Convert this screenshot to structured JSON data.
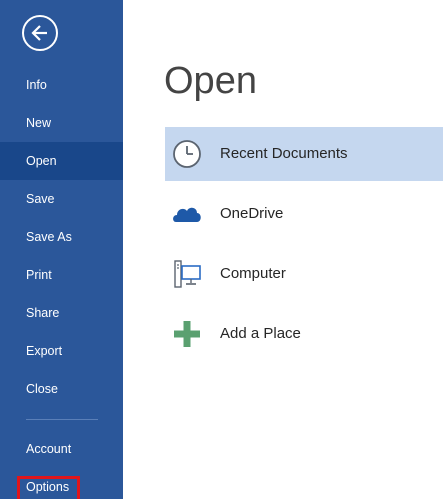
{
  "sidebar": {
    "back_icon": "back-arrow-icon",
    "items": [
      {
        "label": "Info"
      },
      {
        "label": "New"
      },
      {
        "label": "Open"
      },
      {
        "label": "Save"
      },
      {
        "label": "Save As"
      },
      {
        "label": "Print"
      },
      {
        "label": "Share"
      },
      {
        "label": "Export"
      },
      {
        "label": "Close"
      },
      {
        "label": "Account"
      },
      {
        "label": "Options"
      }
    ],
    "active_item": "Open",
    "highlighted_item": "Options"
  },
  "main": {
    "title": "Open",
    "locations": [
      {
        "label": "Recent Documents",
        "icon": "clock-icon",
        "selected": true
      },
      {
        "label": "OneDrive",
        "icon": "cloud-icon",
        "selected": false
      },
      {
        "label": "Computer",
        "icon": "computer-icon",
        "selected": false
      },
      {
        "label": "Add a Place",
        "icon": "plus-icon",
        "selected": false
      }
    ]
  },
  "colors": {
    "sidebar": "#2b579a",
    "sidebar_active": "#19478a",
    "selected_location": "#c5d7ef",
    "highlight_border": "#e0161b",
    "onedrive": "#1e59a8",
    "add_place": "#5aa070"
  }
}
